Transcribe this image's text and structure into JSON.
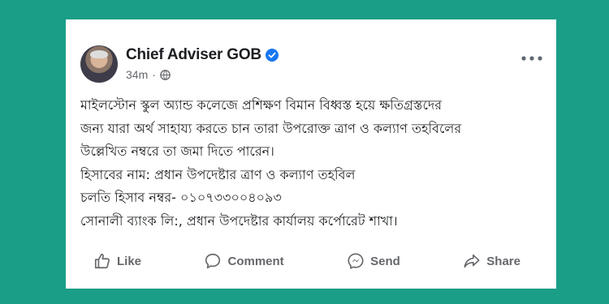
{
  "post": {
    "author": "Chief Adviser GOB",
    "timestamp": "34m",
    "separator": "·",
    "verified": true,
    "privacy_icon": "globe-icon",
    "menu_icon": "more-options-icon",
    "lines": [
      "মাইলস্টোন স্কুল অ্যান্ড কলেজে প্রশিক্ষণ বিমান বিধ্বস্ত হয়ে ক্ষতিগ্রস্তদের",
      "জন্য যারা অর্থ সাহায্য করতে চান তারা উপরোক্ত ত্রাণ ও কল্যাণ তহবিলের",
      "উল্লেখিত নম্বরে তা জমা দিতে পারেন।",
      "হিসাবের নাম: প্রধান উপদেষ্টার ত্রাণ ও কল্যাণ তহবিল",
      "চলতি হিসাব নম্বর- ০১০৭৩৩০০৪০৯৩",
      "সোনালী ব্যাংক লি:, প্রধান উপদেষ্টার কার্যালয় কর্পোরেট শাখা।"
    ]
  },
  "actions": {
    "like": "Like",
    "comment": "Comment",
    "send": "Send",
    "share": "Share"
  },
  "colors": {
    "background": "#1a9e88",
    "card": "#ffffff",
    "verified": "#1877f2",
    "muted": "#65676b"
  }
}
